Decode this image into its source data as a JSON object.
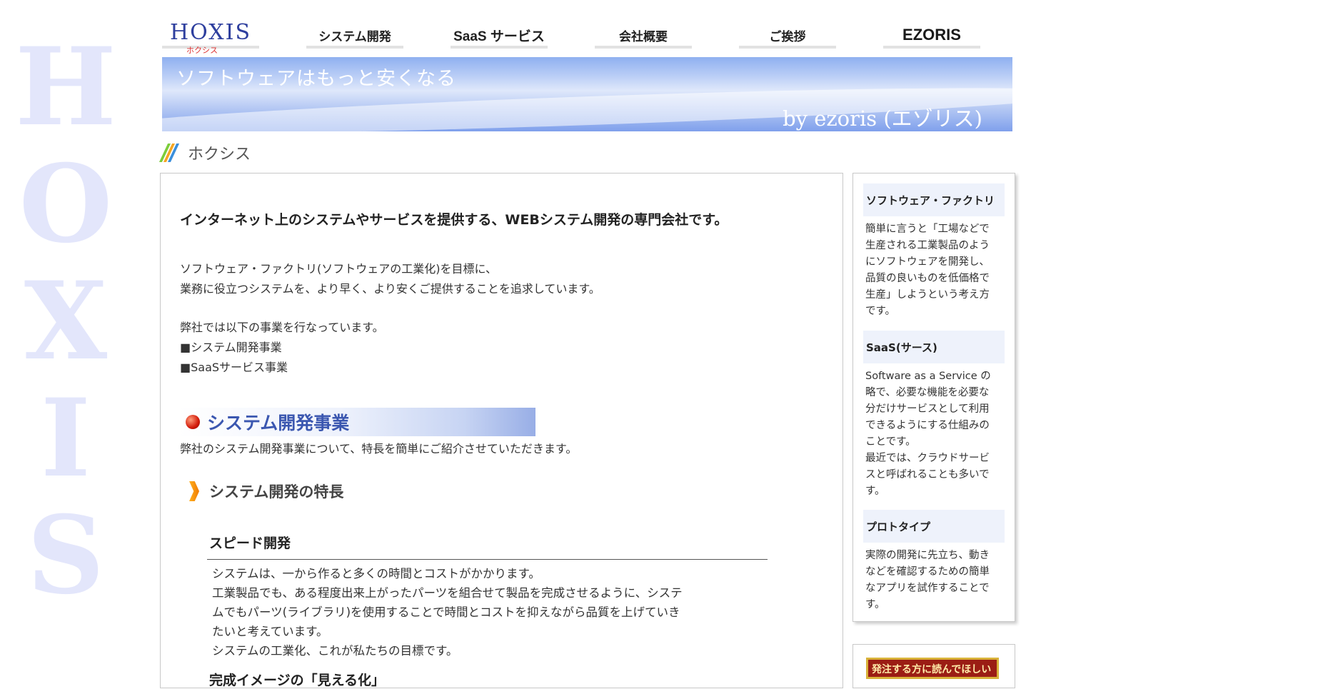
{
  "watermark": {
    "letters": [
      "H",
      "O",
      "X",
      "I",
      "S"
    ]
  },
  "nav": {
    "logo": "HOXIS",
    "logo_kana": "ホクシス",
    "items": [
      "システム開発",
      "SaaS サービス",
      "会社概要",
      "ご挨拶"
    ],
    "ezoris": "EZORIS"
  },
  "banner": {
    "title": "ソフトウェアはもっと安くなる",
    "by": "by ezoris (エゾリス)"
  },
  "breadcrumb": {
    "label": "ホクシス",
    "colors": [
      "#7ccd3b",
      "#f5a623",
      "#3a8fdc"
    ]
  },
  "main": {
    "lead": "インターネット上のシステムやサービスを提供する、WEBシステム開発の専門会社です。",
    "para1": [
      "ソフトウェア・ファクトリ(ソフトウェアの工業化)を目標に、",
      "業務に役立つシステムを、より早く、より安くご提供することを追求しています。"
    ],
    "para2": [
      "弊社では以下の事業を行なっています。",
      "■システム開発事業",
      "■SaaSサービス事業"
    ],
    "section_title": "システム開発事業",
    "section_intro": "弊社のシステム開発事業について、特長を簡単にご紹介させていただきます。",
    "subsection_title": "システム開発の特長",
    "speed": {
      "title": "スピード開発",
      "lines": [
        "システムは、一から作ると多くの時間とコストがかかります。",
        "工業製品でも、ある程度出来上がったパーツを組合せて製品を完成させるように、システ",
        "ムでもパーツ(ライブラリ)を使用することで時間とコストを抑えながら品質を上げていき",
        "たいと考えています。",
        "システムの工業化、これが私たちの目標です。"
      ]
    },
    "next_title": "完成イメージの「見える化」"
  },
  "sidebar": {
    "sections": [
      {
        "title": "ソフトウェア・ファクトリ",
        "lines": [
          "簡単に言うと「工場などで",
          "生産される工業製品のよう",
          "にソフトウェアを開発し、",
          "品質の良いものを低価格で",
          "生産」しようという考え方",
          "です。"
        ]
      },
      {
        "title": "SaaS(サース)",
        "lines": [
          "Software as a Service の",
          "略で、必要な機能を必要な",
          "分だけサービスとして利用",
          "できるようにする仕組みの",
          "ことです。",
          "最近では、クラウドサービ",
          "スと呼ばれることも多いで",
          "す。"
        ]
      },
      {
        "title": "プロトタイプ",
        "lines": [
          "実際の開発に先立ち、動き",
          "などを確認するための簡単",
          "なアプリを試作することで",
          "す。"
        ]
      }
    ],
    "order_button": "発注する方に読んでほしい"
  }
}
